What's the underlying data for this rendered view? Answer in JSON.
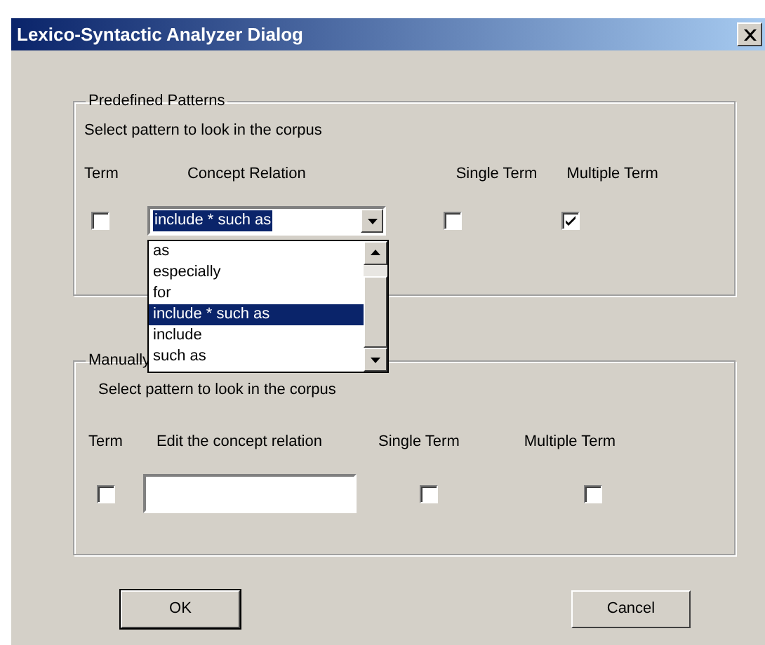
{
  "window": {
    "title": "Lexico-Syntactic Analyzer Dialog"
  },
  "predefined": {
    "legend": "Predefined Patterns",
    "instruction": "Select pattern to look in the corpus",
    "columns": [
      "Term",
      "Concept Relation",
      "Single Term",
      "Multiple Term"
    ],
    "term_checked": false,
    "relation": {
      "value": "include * such as",
      "options": [
        {
          "label": "as",
          "selected": false
        },
        {
          "label": "especially",
          "selected": false
        },
        {
          "label": "for",
          "selected": false
        },
        {
          "label": "include * such as",
          "selected": true
        },
        {
          "label": "include",
          "selected": false
        },
        {
          "label": "such as",
          "selected": false
        }
      ]
    },
    "single_term_checked": false,
    "multiple_term_checked": true
  },
  "manual": {
    "legend": "Manually",
    "instruction": "Select pattern to look in the corpus",
    "columns": [
      "Term",
      "Edit the concept relation",
      "Single Term",
      "Multiple Term"
    ],
    "term_checked": false,
    "single_term_checked": false,
    "multiple_term_checked": false
  },
  "buttons": [
    {
      "label": "OK",
      "default": true
    },
    {
      "label": "Cancel",
      "default": false
    }
  ]
}
